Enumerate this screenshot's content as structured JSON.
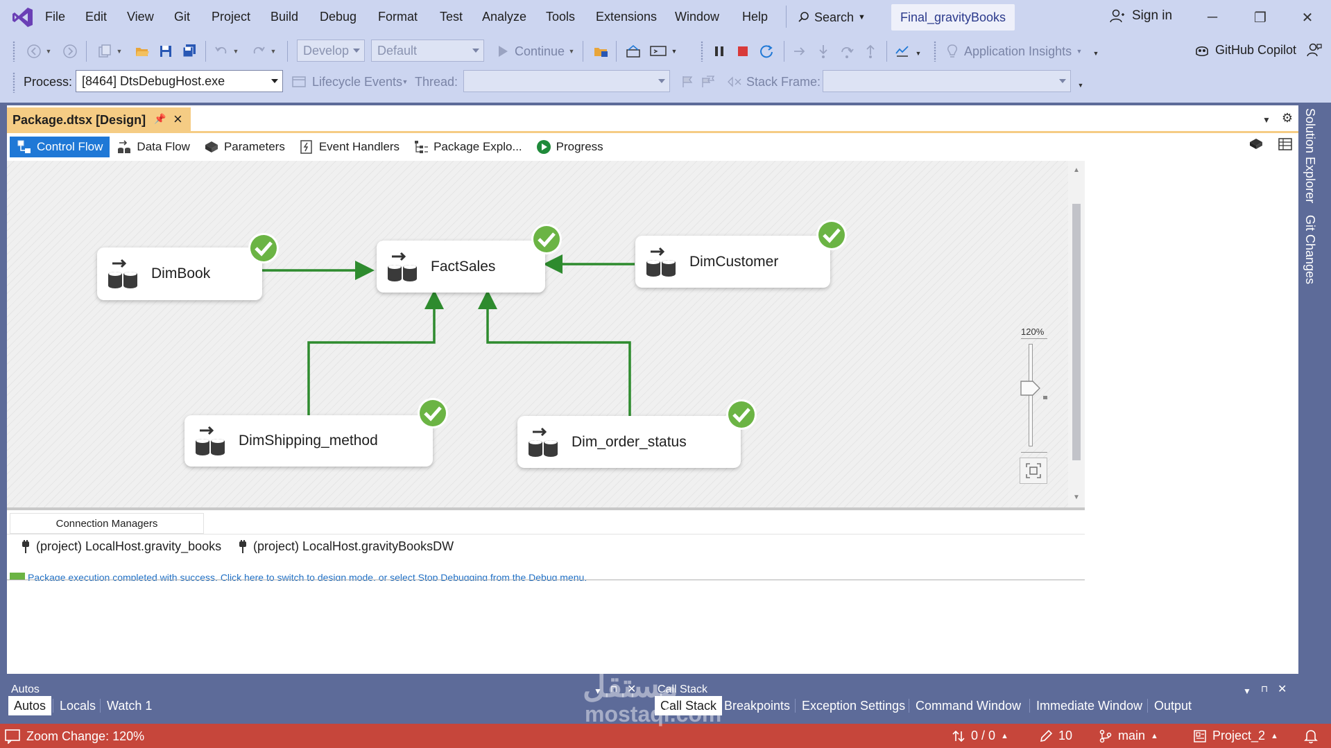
{
  "menu": {
    "items": [
      "File",
      "Edit",
      "View",
      "Git",
      "Project",
      "Build",
      "Debug",
      "Format",
      "Test",
      "Analyze",
      "Tools",
      "Extensions",
      "Window",
      "Help"
    ],
    "search_label": "Search",
    "solution_name": "Final_gravityBooks",
    "sign_in": "Sign in"
  },
  "toolbar": {
    "config_combo": "Develop",
    "platform_combo": "Default",
    "continue_label": "Continue",
    "app_insights": "Application Insights",
    "copilot": "GitHub Copilot"
  },
  "debug_location": {
    "process_label": "Process:",
    "process_value": "[8464] DtsDebugHost.exe",
    "lifecycle_label": "Lifecycle Events",
    "thread_label": "Thread:",
    "stack_frame_label": "Stack Frame:"
  },
  "document": {
    "tab_title": "Package.dtsx [Design]",
    "designer_tabs": [
      "Control Flow",
      "Data Flow",
      "Parameters",
      "Event Handlers",
      "Package Explo...",
      "Progress"
    ]
  },
  "tasks": [
    {
      "name": "DimBook",
      "status": "success"
    },
    {
      "name": "FactSales",
      "status": "success"
    },
    {
      "name": "DimCustomer",
      "status": "success"
    },
    {
      "name": "DimShipping_method",
      "status": "success"
    },
    {
      "name": "Dim_order_status",
      "status": "success"
    }
  ],
  "zoom": {
    "label": "120%",
    "value": 120
  },
  "connection_managers": {
    "tab_label": "Connection Managers",
    "items": [
      "(project) LocalHost.gravity_books",
      "(project) LocalHost.gravityBooksDW"
    ]
  },
  "execution_message": "Package execution completed with success. Click here to switch to design mode, or select Stop Debugging from the Debug menu.",
  "right_rail": [
    "Solution Explorer",
    "Git Changes"
  ],
  "bottom_panels": {
    "left_title": "Autos",
    "right_title": "Call Stack",
    "left_tabs": [
      "Autos",
      "Locals",
      "Watch 1"
    ],
    "right_tabs": [
      "Call Stack",
      "Breakpoints",
      "Exception Settings",
      "Command Window",
      "Immediate Window",
      "Output"
    ]
  },
  "status_bar": {
    "message": "Zoom Change: 120%",
    "line_changes": "0 / 0",
    "edits": "10",
    "branch": "main",
    "project": "Project_2"
  },
  "watermark": {
    "line1": "مستقل",
    "line2": "mostaql.com"
  },
  "colors": {
    "accent": "#1f78d6",
    "status_bar": "#c6463b",
    "success": "#6bb444",
    "connector": "#2e8b2e",
    "doc_tab": "#f5cc84"
  }
}
